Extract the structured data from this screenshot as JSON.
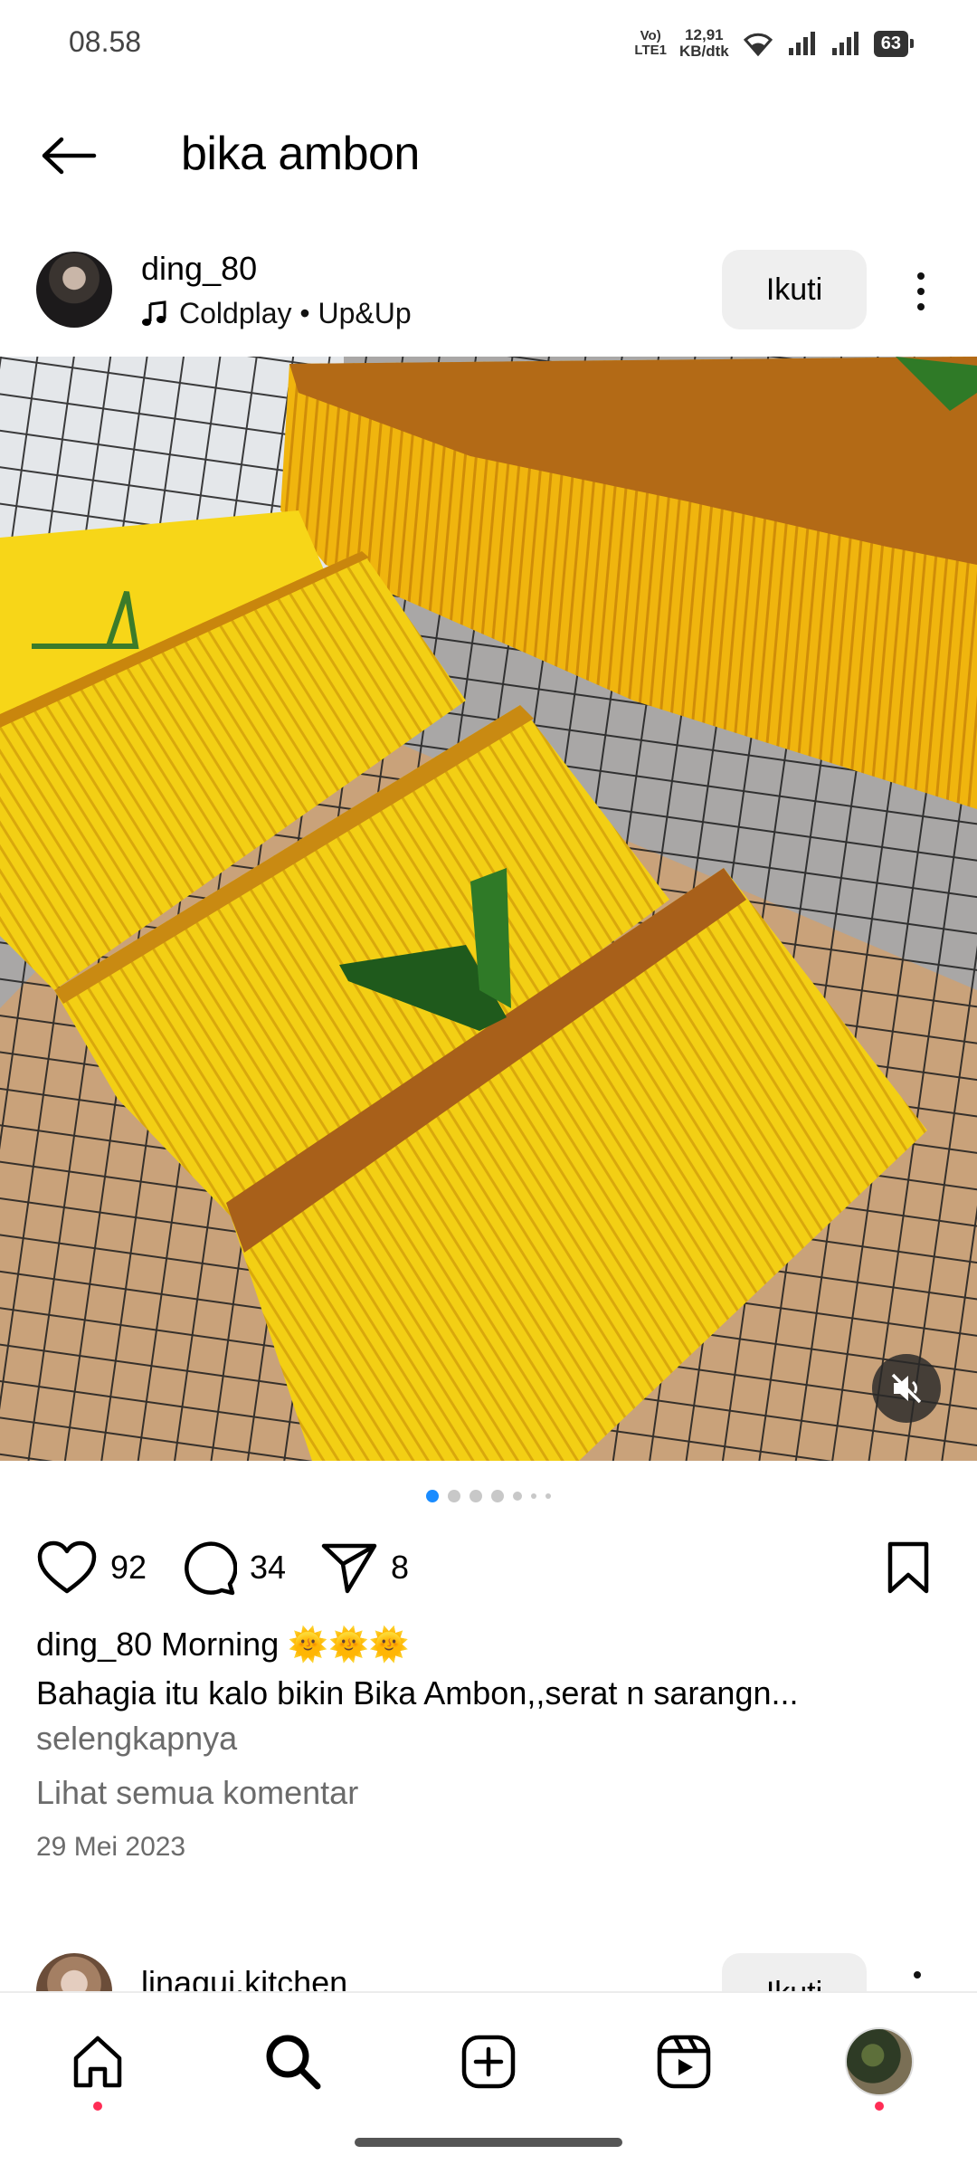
{
  "status_bar": {
    "time": "08.58",
    "volte_top": "Vo)",
    "volte_bottom": "LTE1",
    "speed_top": "12,91",
    "speed_bottom": "KB/dtk",
    "battery": "63"
  },
  "header": {
    "title": "bika ambon",
    "back_icon": "arrow-left-icon"
  },
  "post": {
    "username": "ding_80",
    "music_icon": "music-note-icon",
    "music": "Coldplay • Up&Up",
    "follow_label": "Ikuti",
    "more_icon": "more-vertical-icon",
    "media_description_icon": "photo",
    "mute_icon": "muted-speaker-icon",
    "carousel": {
      "count": 7,
      "active_index": 0
    },
    "actions": {
      "likes": "92",
      "comments": "34",
      "shares": "8"
    },
    "caption": {
      "username": "ding_80",
      "text": "Morning",
      "emoji": "🌞🌞🌞",
      "line2": "Bahagia itu kalo bikin Bika Ambon,,serat n sarangn...",
      "see_more": "selengkapnya"
    },
    "view_comments": "Lihat semua komentar",
    "date": "29 Mei 2023"
  },
  "next_post": {
    "username": "linagui.kitchen",
    "follow_label": "Ikuti"
  },
  "bottom_nav": {
    "items": [
      "home-icon",
      "search-icon",
      "create-icon",
      "reels-icon",
      "profile-avatar"
    ],
    "accent": "#ff2d55"
  },
  "colors": {
    "accent_blue": "#1a8cff",
    "secondary_text": "#6b6b6b"
  }
}
